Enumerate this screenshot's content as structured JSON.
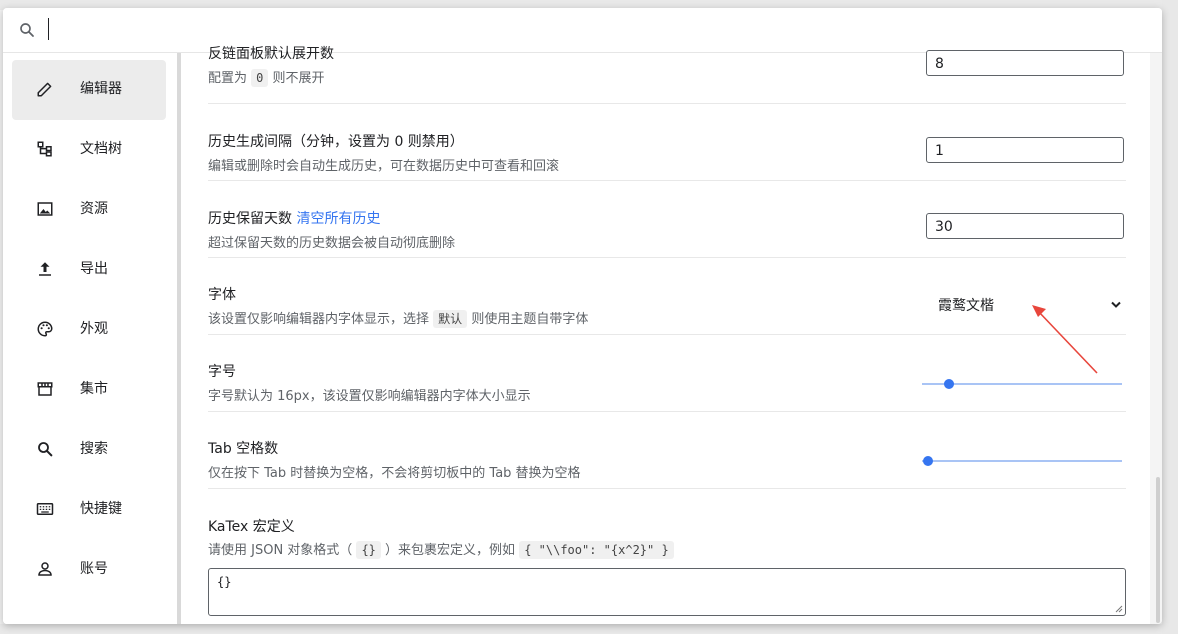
{
  "search": {
    "value": "",
    "placeholder": ""
  },
  "sidebar": {
    "items": [
      {
        "label": "编辑器",
        "icon": "pencil-icon",
        "active": true
      },
      {
        "label": "文档树",
        "icon": "tree-icon",
        "active": false
      },
      {
        "label": "资源",
        "icon": "image-icon",
        "active": false
      },
      {
        "label": "导出",
        "icon": "upload-icon",
        "active": false
      },
      {
        "label": "外观",
        "icon": "palette-icon",
        "active": false
      },
      {
        "label": "集市",
        "icon": "store-icon",
        "active": false
      },
      {
        "label": "搜索",
        "icon": "search-icon",
        "active": false
      },
      {
        "label": "快捷键",
        "icon": "keyboard-icon",
        "active": false
      },
      {
        "label": "账号",
        "icon": "person-icon",
        "active": false
      }
    ]
  },
  "settings": {
    "backlink": {
      "title": "反链面板默认展开数",
      "desc_prefix": "配置为",
      "desc_code": "0",
      "desc_suffix": "则不展开",
      "value": "8"
    },
    "history_interval": {
      "title": "历史生成间隔（分钟，设置为 0 则禁用）",
      "desc": "编辑或删除时会自动生成历史，可在数据历史中可查看和回滚",
      "value": "1"
    },
    "history_keep": {
      "title": "历史保留天数",
      "link": "清空所有历史",
      "desc": "超过保留天数的历史数据会被自动彻底删除",
      "value": "30"
    },
    "font": {
      "title": "字体",
      "desc_prefix": "该设置仅影响编辑器内字体显示，选择",
      "desc_code": "默认",
      "desc_suffix": "则使用主题自带字体",
      "value": "霞鹜文楷"
    },
    "font_size": {
      "title": "字号",
      "desc": "字号默认为 16px，该设置仅影响编辑器内字体大小显示"
    },
    "tab_space": {
      "title": "Tab 空格数",
      "desc": "仅在按下 Tab 时替换为空格，不会将剪切板中的 Tab 替换为空格"
    },
    "katex": {
      "title": "KaTex 宏定义",
      "desc_prefix": "请使用 JSON 对象格式（",
      "desc_code1": "{}",
      "desc_middle": "）来包裹宏定义，例如",
      "desc_code2": "{ \"\\\\foo\": \"{x^2}\" }",
      "value": "{}"
    }
  },
  "colors": {
    "accent": "#3575f0",
    "annotation": "#e8463c"
  }
}
